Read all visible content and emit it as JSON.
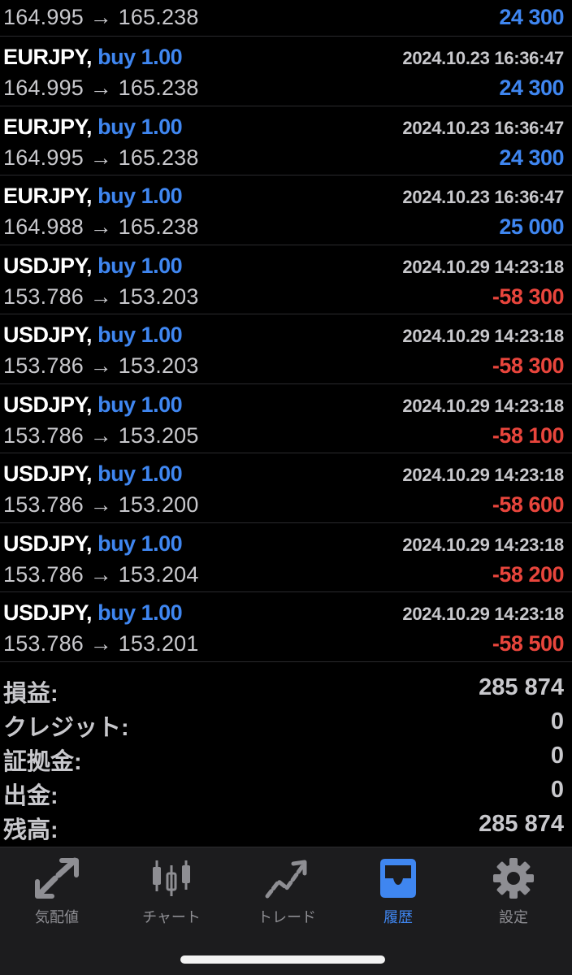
{
  "deals": [
    {
      "symbol": "",
      "side": "",
      "time": "",
      "from": "164.995",
      "to": "165.238",
      "profit": "24 300",
      "sign": "pos",
      "partial": true
    },
    {
      "symbol": "EURJPY,",
      "side": "buy 1.00",
      "time": "2024.10.23 16:36:47",
      "from": "164.995",
      "to": "165.238",
      "profit": "24 300",
      "sign": "pos"
    },
    {
      "symbol": "EURJPY,",
      "side": "buy 1.00",
      "time": "2024.10.23 16:36:47",
      "from": "164.995",
      "to": "165.238",
      "profit": "24 300",
      "sign": "pos"
    },
    {
      "symbol": "EURJPY,",
      "side": "buy 1.00",
      "time": "2024.10.23 16:36:47",
      "from": "164.988",
      "to": "165.238",
      "profit": "25 000",
      "sign": "pos"
    },
    {
      "symbol": "USDJPY,",
      "side": "buy 1.00",
      "time": "2024.10.29 14:23:18",
      "from": "153.786",
      "to": "153.203",
      "profit": "-58 300",
      "sign": "neg"
    },
    {
      "symbol": "USDJPY,",
      "side": "buy 1.00",
      "time": "2024.10.29 14:23:18",
      "from": "153.786",
      "to": "153.203",
      "profit": "-58 300",
      "sign": "neg"
    },
    {
      "symbol": "USDJPY,",
      "side": "buy 1.00",
      "time": "2024.10.29 14:23:18",
      "from": "153.786",
      "to": "153.205",
      "profit": "-58 100",
      "sign": "neg"
    },
    {
      "symbol": "USDJPY,",
      "side": "buy 1.00",
      "time": "2024.10.29 14:23:18",
      "from": "153.786",
      "to": "153.200",
      "profit": "-58 600",
      "sign": "neg"
    },
    {
      "symbol": "USDJPY,",
      "side": "buy 1.00",
      "time": "2024.10.29 14:23:18",
      "from": "153.786",
      "to": "153.204",
      "profit": "-58 200",
      "sign": "neg"
    },
    {
      "symbol": "USDJPY,",
      "side": "buy 1.00",
      "time": "2024.10.29 14:23:18",
      "from": "153.786",
      "to": "153.201",
      "profit": "-58 500",
      "sign": "neg"
    }
  ],
  "arrow": "→",
  "summary": [
    {
      "label": "損益:",
      "value": "285 874"
    },
    {
      "label": "クレジット:",
      "value": "0"
    },
    {
      "label": "証拠金:",
      "value": "0"
    },
    {
      "label": "出金:",
      "value": "0"
    },
    {
      "label": "残高:",
      "value": "285 874"
    }
  ],
  "tabs": [
    {
      "label": "気配値",
      "icon": "quotes-arrows-icon",
      "active": false
    },
    {
      "label": "チャート",
      "icon": "candlestick-chart-icon",
      "active": false
    },
    {
      "label": "トレード",
      "icon": "trade-trend-icon",
      "active": false
    },
    {
      "label": "履歴",
      "icon": "history-tray-icon",
      "active": true
    },
    {
      "label": "設定",
      "icon": "gear-icon",
      "active": false
    }
  ],
  "colors": {
    "accent": "#3f86f0",
    "loss": "#e8453c",
    "background": "#000000",
    "tabbar": "#1c1c1e"
  }
}
